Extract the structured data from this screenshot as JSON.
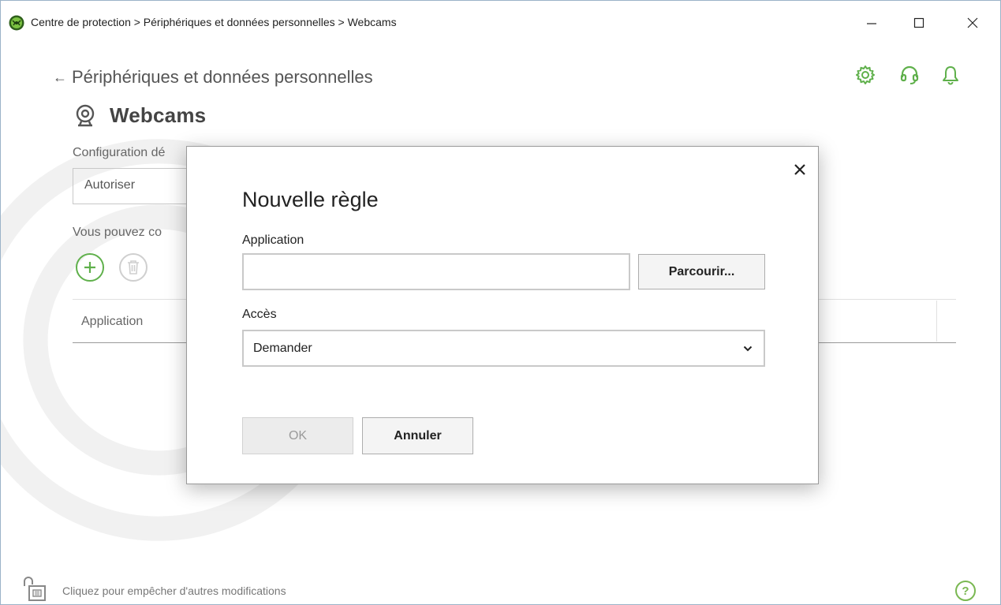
{
  "window": {
    "title": "Centre de protection > Périphériques et données personnelles > Webcams",
    "controls": {
      "minimize": "–",
      "maximize": "☐",
      "close": "✕"
    }
  },
  "header": {
    "back_label": "Périphériques et données personnelles",
    "page_title": "Webcams",
    "icons": [
      "gear-icon",
      "support-headset-icon",
      "bell-icon"
    ]
  },
  "background": {
    "config_label": "Configuration dé",
    "config_value": "Autoriser",
    "can_label": "Vous pouvez co",
    "table_header_application": "Application"
  },
  "footer": {
    "lock_text": "Cliquez pour empêcher d'autres modifications",
    "help": "?"
  },
  "dialog": {
    "title": "Nouvelle règle",
    "close": "×",
    "application_label": "Application",
    "application_value": "",
    "browse_label": "Parcourir...",
    "access_label": "Accès",
    "access_value": "Demander",
    "ok_label": "OK",
    "cancel_label": "Annuler"
  },
  "colors": {
    "accent_green": "#5fb04b",
    "dialog_border": "#9a9a9a",
    "disabled_text": "#9a9a9a"
  }
}
